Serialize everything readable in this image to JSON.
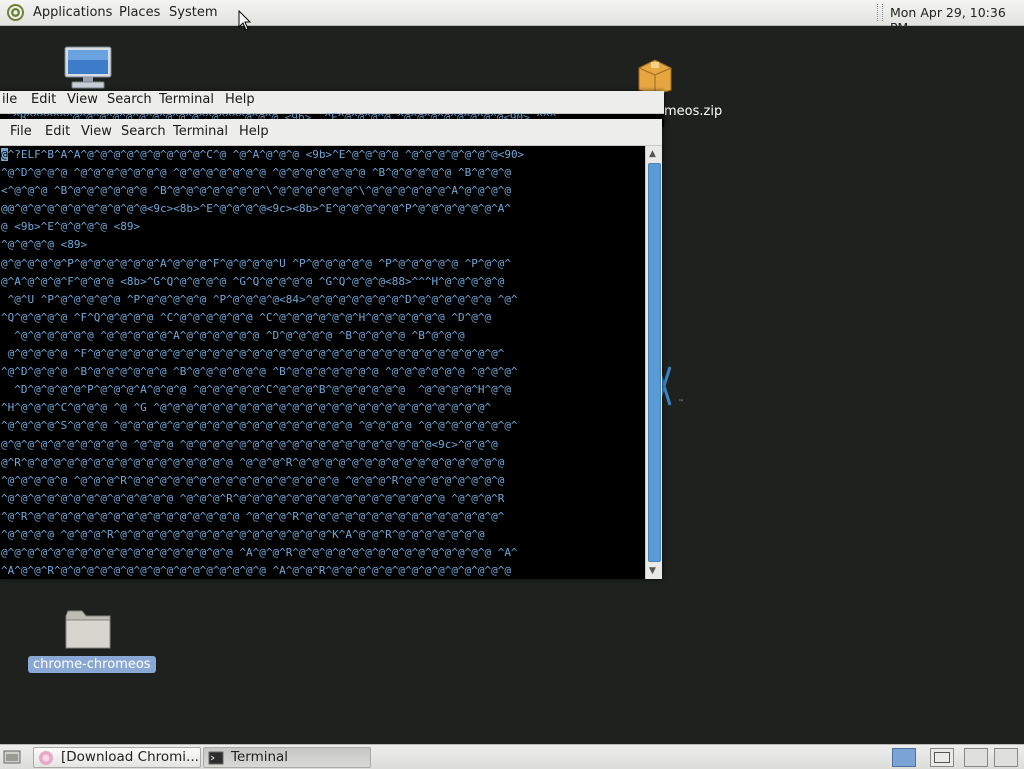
{
  "top_panel": {
    "menus": [
      "Applications",
      "Places",
      "System"
    ],
    "clock": "Mon Apr 29, 10:36 PM"
  },
  "desktop": {
    "icons": [
      {
        "name": "computer-icon",
        "label": ""
      },
      {
        "name": "zip-icon",
        "label": "chromeos.zip",
        "label_visible": "meos.zip"
      },
      {
        "name": "folder-icon",
        "label": "chrome-chromeos"
      }
    ]
  },
  "back_terminal": {
    "menu": [
      "File",
      "Edit",
      "View",
      "Search",
      "Terminal",
      "Help"
    ],
    "menu_visible_first": "ile",
    "top_line": "  ^B^^^^^^^@^@^@^@^@^@^@^@^@^@^^@^^^^@^@^@ <9b>  ^E^@^@^@^@ ^@^@^@^@^@^@^@^@<90> ^^^"
  },
  "front_terminal": {
    "menu": [
      "File",
      "Edit",
      "View",
      "Search",
      "Terminal",
      "Help"
    ],
    "lines": [
      "@^?ELF^B^A^A^@^@^@^@^@^@^@^@^@^C^@ ^@^A^@^@^@ <9b>^E^@^@^@^@ ^@^@^@^@^@^@^@<90>",
      "^@^D^@^@^@ ^@^@^@^@^@^@^@ ^@^@^@^@^@^@^@ ^@^@^@^@^@^@^@ ^B^@^@^@^@^@ ^B^@^@^@",
      "<^@^@^@ ^B^@^@^@^@^@^@ ^B^@^@^@^@^@^@^@^\\^@^@^@^@^@^@^\\^@^@^@^@^@^@^A^@^@^@^@",
      "@@^@^@^@^@^@^@^@^@^@^@<9c><8b>^E^@^@^@^@<9c><8b>^E^@^@^@^@^@^P^@^@^@^@^@^@^A^",
      "@ <9b>^E^@^@^@^@ <89>",
      "^@^@^@^@ <89>",
      "@^@^@^@^@^P^@^@^@^@^@^@^A^@^@^@^F^@^@^@^@^U ^P^@^@^@^@^@ ^P^@^@^@^@^@ ^P^@^@^",
      "@^A^@^@^@^F^@^@^@ <8b>^G^Q^@^@^@^@ ^G^Q^@^@^@^@ ^G^Q^@^@^@<88>^^^H^@^@^@^@^@",
      " ^@^U ^P^@^@^@^@^@ ^P^@^@^@^@^@ ^P^@^@^@^@<84>^@^@^@^@^@^@^@^D^@^@^@^@^@^@ ^@^",
      "^Q^@^@^@^@ ^F^Q^@^@^@^@ ^C^@^@^@^@^@^@ ^C^@^@^@^@^@^@^H^@^@^@^@^@^@ ^D^@^@",
      "  ^@^@^@^@^@^@ ^@^@^@^@^@^A^@^@^@^@^@^@ ^D^@^@^@^@ ^B^@^@^@^@ ^B^@^@^@",
      " @^@^@^@^@ ^F^@^@^@^@^@^@^@^@^@^@^@^@^@^@^@^@^@^@^@^@^@^@^@^@^@^@^@^@^@^@^@^",
      "^@^D^@^@^@ ^B^@^@^@^@^@^@ ^B^@^@^@^@^@^@ ^B^@^@^@^@^@^@^@ ^@^@^@^@^@^@ ^@^@^@^",
      "  ^D^@^@^@^@^P^@^@^@^A^@^@^@ ^@^@^@^@^@^C^@^@^@^B^@^@^@^@^@^@  ^@^@^@^@^H^@^@",
      "^H^@^@^@^C^@^@^@ ^@ ^G ^@^@^@^@^@^@^@^@^@^@^@^@^@^@^@^@^@^@^@^@^@^@^@^@^@^",
      "^@^@^@^@^S^@^@^@ ^@^@^@^@^@^@^@^@^@^@^@^@^@^@^@^@^@^@ ^@^@^@^@ ^@^@^@^@^@^@^@^",
      "@^@^@^@^@^@^@^@^@^@ ^@^@^@ ^@^@^@^@^@^@^@^@^@^@^@^@^@^@^@^@^@^@^@<9c>^@^@^@",
      "@^R^@^@^@^@^@^@^@^@^@^@^@^@^@^@^@^@ ^@^@^@^R^@^@^@^@^@^@^@^@^@^@^@^@^@^@^@^@",
      "^@^@^@^@^@ ^@^@^@^R^@^@^@^@^@^@^@^@^@^@^@^@^@^@^@^@ ^@^@^@^R^@^@^@^@^@^@^@^@",
      "^@^@^@^@^@^@^@^@^@^@^@^@^@ ^@^@^@^R^@^@^@^@^@^@^@^@^@^@^@^@^@^@^@^@ ^@^@^@^R",
      "^@^R^@^@^@^@^@^@^@^@^@^@^@^@^@^@^@^@ ^@^@^@^R^@^@^@^@^@^@^@^@^@^@^@^@^@^@^@^",
      "^@^@^@^@ ^@^@^@^R^@^@^@^@^@^@^@^@^@^@^@^@^@^@^@^@^K^A^@^@^R^@^@^@^@^@^@^@",
      "@^@^@^@^@^@^@^@^@^@^@^@^@^@^@^@^@^@ ^A^@^@^R^@^@^@^@^@^@^@^@^@^@^@^@^@^@^@ ^A^",
      "^A^@^@^R^@^@^@^@^@^@^@^@^@^@^@^@^@^@^@^@ ^A^@^@^R^@^@^@^@^@^@^@^@^@^@^@^@^@^@"
    ]
  },
  "taskbar": {
    "tasks": [
      {
        "label": "[Download Chromi...",
        "icon": "browser-icon"
      },
      {
        "label": "Terminal",
        "icon": "terminal-icon"
      }
    ]
  },
  "colors": {
    "desktop_bg": "#1e211e",
    "terminal_fg": "#6fa8d8",
    "selection": "#8aa8d4"
  }
}
